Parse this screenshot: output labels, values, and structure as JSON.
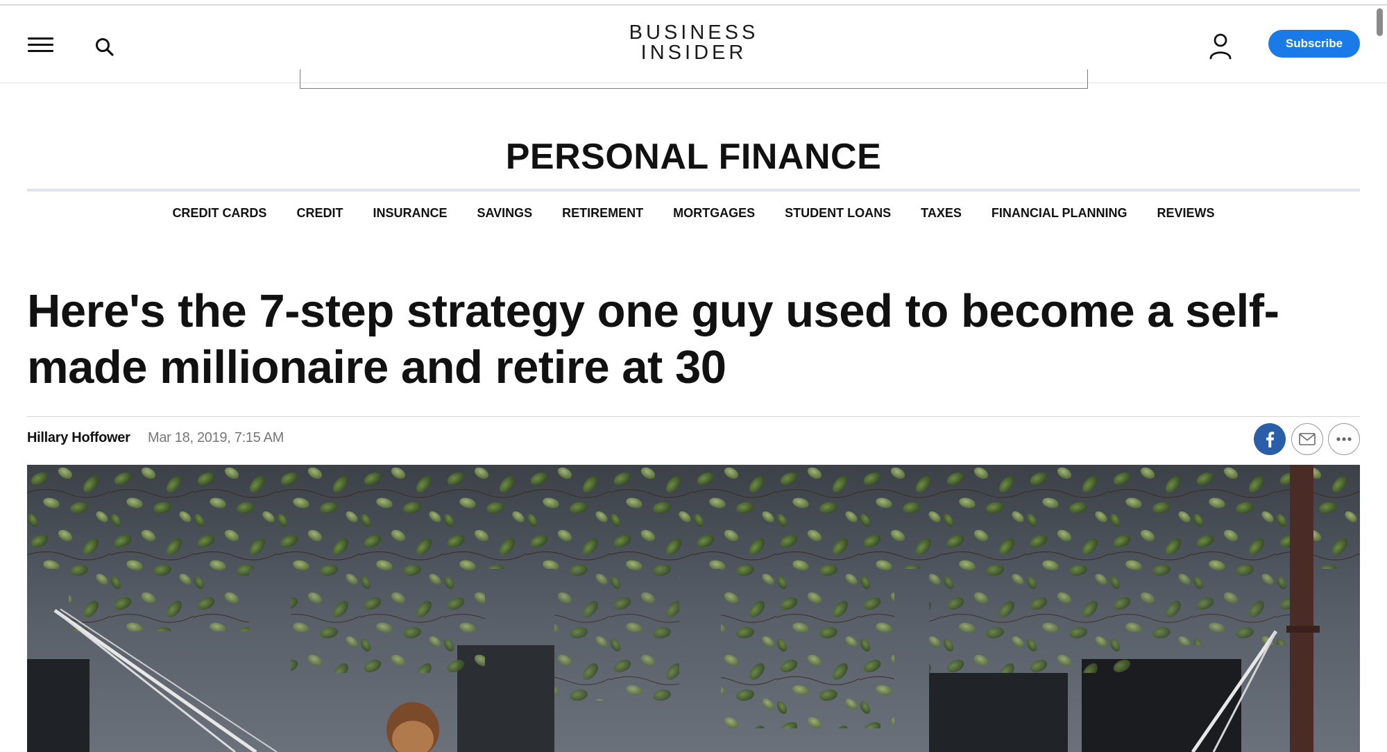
{
  "header": {
    "logo_line1": "BUSINESS",
    "logo_line2": "INSIDER",
    "subscribe_label": "Subscribe"
  },
  "section": {
    "title": "PERSONAL FINANCE",
    "nav": [
      {
        "label": "CREDIT CARDS"
      },
      {
        "label": "CREDIT"
      },
      {
        "label": "INSURANCE"
      },
      {
        "label": "SAVINGS"
      },
      {
        "label": "RETIREMENT"
      },
      {
        "label": "MORTGAGES"
      },
      {
        "label": "STUDENT LOANS"
      },
      {
        "label": "TAXES"
      },
      {
        "label": "FINANCIAL PLANNING"
      },
      {
        "label": "REVIEWS"
      }
    ]
  },
  "article": {
    "headline": "Here's the 7-step strategy one guy used to become a self-made millionaire and retire at 30",
    "author": "Hillary Hoffower",
    "date": "Mar 18, 2019, 7:15 AM"
  },
  "colors": {
    "subscribe_blue": "#1a7ae8",
    "facebook_blue": "#2a5fa8",
    "section_rule": "#dde4ec"
  },
  "icons": {
    "menu": "hamburger-menu-icon",
    "search": "search-icon",
    "account": "user-account-icon",
    "facebook": "facebook-icon",
    "email": "email-icon",
    "more": "more-options-icon"
  }
}
